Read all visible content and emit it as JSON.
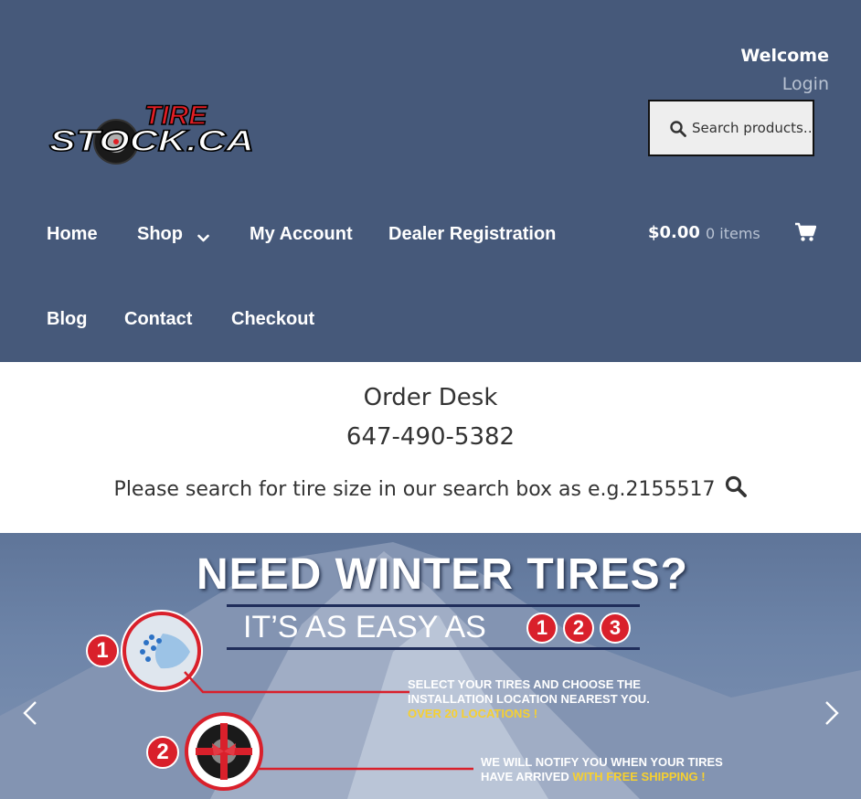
{
  "header": {
    "logo_text_top": "TIRE",
    "logo_text_bottom": "STOCK.CA",
    "welcome": "Welcome",
    "login": "Login",
    "search": {
      "placeholder": "Search products…",
      "icon": "search-icon"
    }
  },
  "nav": {
    "items": [
      {
        "label": "Home"
      },
      {
        "label": "Shop",
        "icon": "chevron-down-icon"
      },
      {
        "label": "My Account"
      },
      {
        "label": "Dealer Registration"
      },
      {
        "label": "Blog"
      },
      {
        "label": "Contact"
      },
      {
        "label": "Checkout"
      }
    ]
  },
  "cart": {
    "total": "$0.00",
    "count": "0 items",
    "icon": "cart-icon"
  },
  "info": {
    "title": "Order Desk",
    "phone": "647-490-5382",
    "hint": "Please search for tire size in our search box as e.g.2155517",
    "hint_icon": "search-icon"
  },
  "hero": {
    "headline": "NEED WINTER TIRES?",
    "subheadline_prefix": "IT’S AS EASY AS",
    "steps_numbers": [
      "1",
      "2",
      "3"
    ],
    "step1": {
      "number": "1",
      "line1": "SELECT YOUR TIRES AND CHOOSE THE",
      "line2": "INSTALLATION LOCATION NEAREST YOU.",
      "highlight": "OVER 20 LOCATIONS !"
    },
    "step2": {
      "number": "2",
      "line1": "WE WILL NOTIFY YOU WHEN YOUR TIRES",
      "line2_prefix": "HAVE ARRIVED",
      "highlight": "WITH FREE SHIPPING !"
    },
    "prev_icon": "chevron-left-icon",
    "next_icon": "chevron-right-icon"
  },
  "colors": {
    "header_bg": "#46597a",
    "accent_red": "#d9202b",
    "highlight_yellow": "#f6d030"
  }
}
